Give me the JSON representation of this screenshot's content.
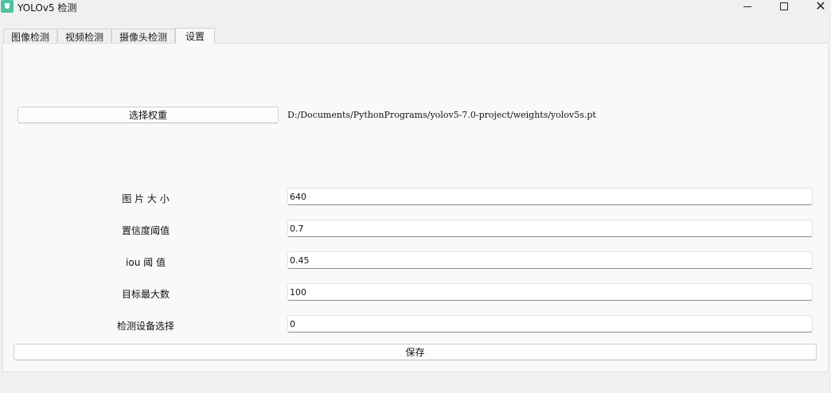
{
  "window": {
    "title": "YOLOv5 检测",
    "close_glyph": "✕"
  },
  "tabs": [
    {
      "label": "图像检测",
      "active": false
    },
    {
      "label": "视频检测",
      "active": false
    },
    {
      "label": "摄像头检测",
      "active": false
    },
    {
      "label": "设置",
      "active": true
    }
  ],
  "settings": {
    "select_weights_label": "选择权重",
    "weights_path": "D:/Documents/PythonPrograms/yolov5-7.0-project/weights/yolov5s.pt",
    "fields": [
      {
        "label": "图 片 大 小",
        "value": "640"
      },
      {
        "label": "置信度阈值",
        "value": "0.7"
      },
      {
        "label": "iou 阈 值",
        "value": "0.45"
      },
      {
        "label": "目标最大数",
        "value": "100"
      },
      {
        "label": "检测设备选择",
        "value": "0"
      }
    ],
    "save_label": "保存"
  },
  "colors": {
    "app_icon": "#4fc3a1",
    "panel_background": "#f9f9f9",
    "window_background": "#f0f0f0"
  }
}
